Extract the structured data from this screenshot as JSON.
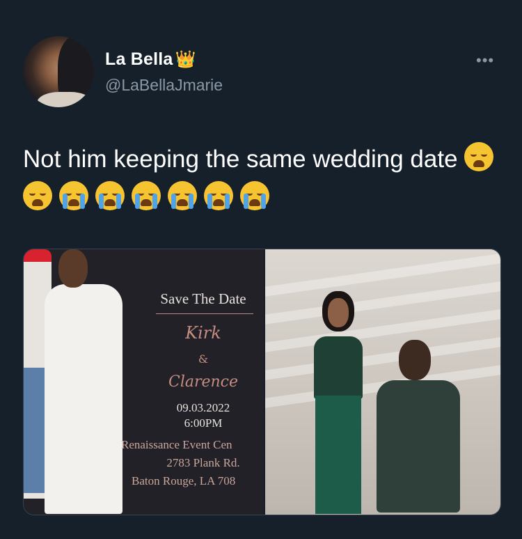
{
  "tweet": {
    "display_name": "La Bella",
    "name_emoji": "👑",
    "handle": "@LaBellaJmarie",
    "more": "•••",
    "text": "Not him keeping the same wedding date",
    "emojis": [
      "weary-face",
      "weary-face",
      "loudly-crying-face",
      "loudly-crying-face",
      "loudly-crying-face",
      "loudly-crying-face",
      "loudly-crying-face",
      "loudly-crying-face"
    ]
  },
  "invitation": {
    "title": "Save The Date",
    "name1": "Kirk",
    "amp": "&",
    "name2": "Clarence",
    "date": "09.03.2022",
    "time": "6:00PM",
    "venue": "Renaissance Event Cen",
    "address1": "2783 Plank Rd.",
    "address2": "Baton Rouge, LA 708"
  },
  "colors": {
    "background": "#15202b",
    "secondary_text": "#8b98a5",
    "accent_script": "#c48d80"
  }
}
